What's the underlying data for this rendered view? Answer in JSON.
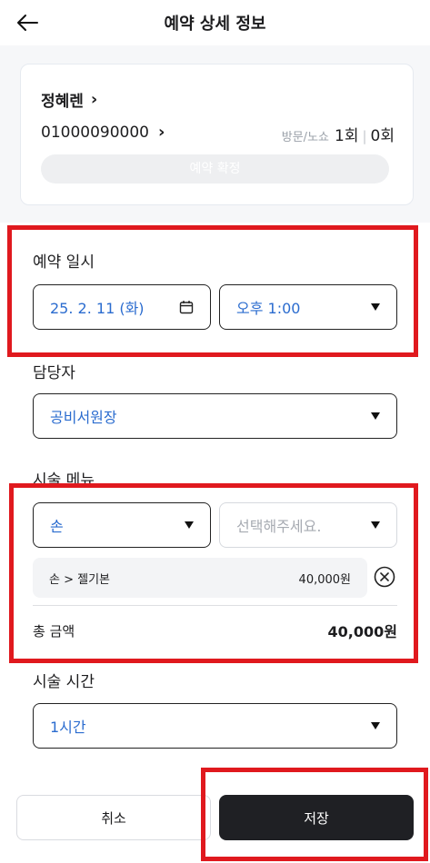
{
  "header": {
    "title": "예약 상세 정보",
    "back_icon": "arrow-left-icon"
  },
  "customer": {
    "name": "정혜렌",
    "phone": "01000090000",
    "visit_label": "방문/노쇼",
    "visit_count": "1회",
    "noshow_count": "0회",
    "confirm_label": "예약 확정"
  },
  "reservation": {
    "label": "예약 일시",
    "date": "25. 2. 11 (화)",
    "time": "오후 1:00"
  },
  "staff": {
    "label": "담당자",
    "value": "공비서원장"
  },
  "menu": {
    "label": "시술 메뉴",
    "category": "손",
    "sub_placeholder": "선택해주세요.",
    "selected_item": {
      "name": "손 > 젤기본",
      "price": "40,000원"
    },
    "total_label": "총 금액",
    "total_value": "40,000원"
  },
  "duration": {
    "label": "시술 시간",
    "value": "1시간"
  },
  "actions": {
    "cancel_label": "취소",
    "save_label": "저장"
  },
  "colors": {
    "accent": "#2b6ccf",
    "highlight": "#e0191e",
    "save_bg": "#1f2024"
  }
}
